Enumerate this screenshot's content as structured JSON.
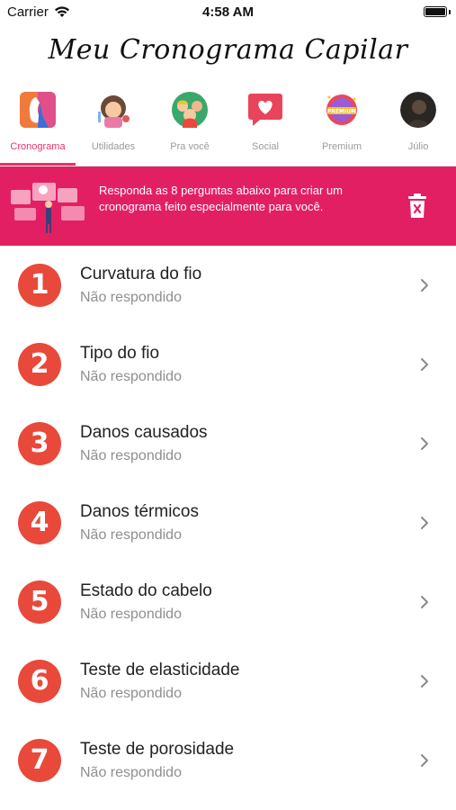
{
  "status_bar": {
    "carrier": "Carrier",
    "time": "4:58 AM"
  },
  "app": {
    "title": "Meu Cronograma Capilar"
  },
  "tabs": [
    {
      "label": "Cronograma",
      "icon": "cronograma-icon",
      "active": true
    },
    {
      "label": "Utilidades",
      "icon": "utilidades-icon",
      "active": false
    },
    {
      "label": "Pra você",
      "icon": "pra-voce-icon",
      "active": false
    },
    {
      "label": "Social",
      "icon": "social-heart-icon",
      "active": false
    },
    {
      "label": "Premium",
      "icon": "premium-badge-icon",
      "active": false
    },
    {
      "label": "Júlio",
      "icon": "avatar",
      "active": false
    }
  ],
  "banner": {
    "text": "Responda as 8 perguntas abaixo para criar um cronograma feito especialmente para você.",
    "color": "#e31f63"
  },
  "questions": [
    {
      "number": "1",
      "title": "Curvatura do fio",
      "status": "Não respondido"
    },
    {
      "number": "2",
      "title": "Tipo do fio",
      "status": "Não respondido"
    },
    {
      "number": "3",
      "title": "Danos causados",
      "status": "Não respondido"
    },
    {
      "number": "4",
      "title": "Danos térmicos",
      "status": "Não respondido"
    },
    {
      "number": "5",
      "title": "Estado do cabelo",
      "status": "Não respondido"
    },
    {
      "number": "6",
      "title": "Teste de elasticidade",
      "status": "Não respondido"
    },
    {
      "number": "7",
      "title": "Teste de porosidade",
      "status": "Não respondido"
    }
  ],
  "colors": {
    "accent": "#e8336b",
    "badge": "#e8493b"
  }
}
